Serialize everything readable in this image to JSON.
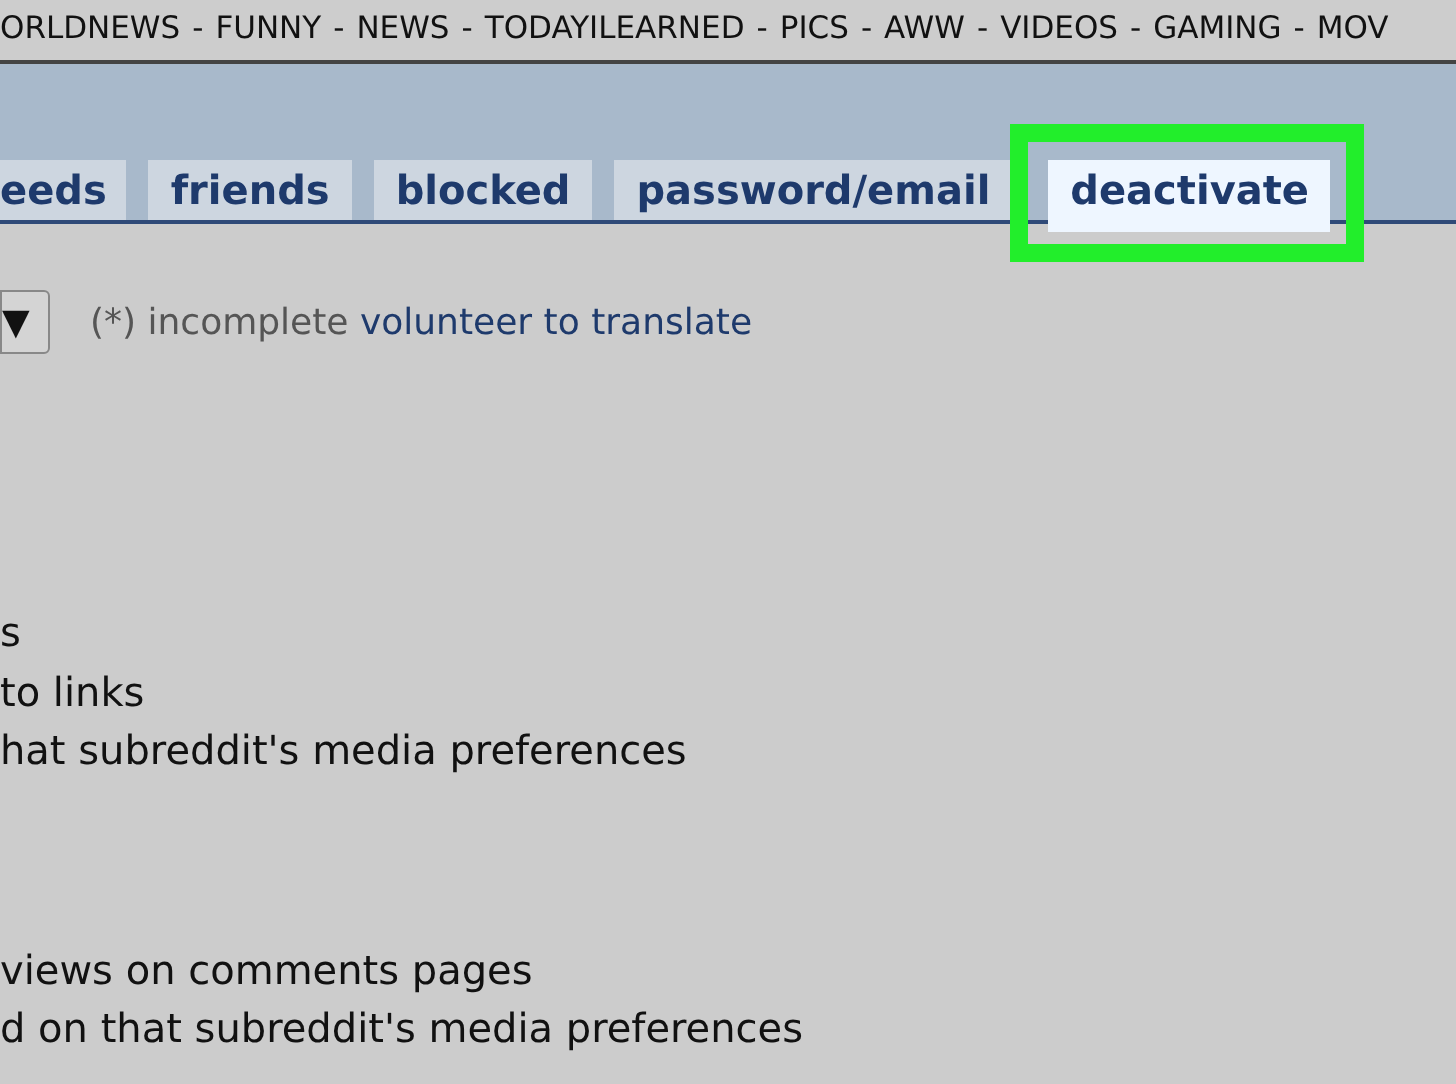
{
  "top_menu": {
    "items": [
      "ORLDNEWS",
      "FUNNY",
      "NEWS",
      "TODAYILEARNED",
      "PICS",
      "AWW",
      "VIDEOS",
      "GAMING",
      "MOV"
    ],
    "separator": "-"
  },
  "tabs": [
    {
      "label": "eeds",
      "selected": false,
      "highlighted": false
    },
    {
      "label": "friends",
      "selected": false,
      "highlighted": false
    },
    {
      "label": "blocked",
      "selected": false,
      "highlighted": false
    },
    {
      "label": "password/email",
      "selected": false,
      "highlighted": false
    },
    {
      "label": "deactivate",
      "selected": true,
      "highlighted": true
    }
  ],
  "language": {
    "dropdown_arrow": "▼",
    "note": "(*) incomplete",
    "link": "volunteer to translate"
  },
  "option_groups": [
    {
      "lines": [
        "s",
        "to links",
        "hat subreddit's media preferences"
      ]
    },
    {
      "lines": [
        "views on comments pages",
        "d on that subreddit's media preferences"
      ]
    }
  ]
}
